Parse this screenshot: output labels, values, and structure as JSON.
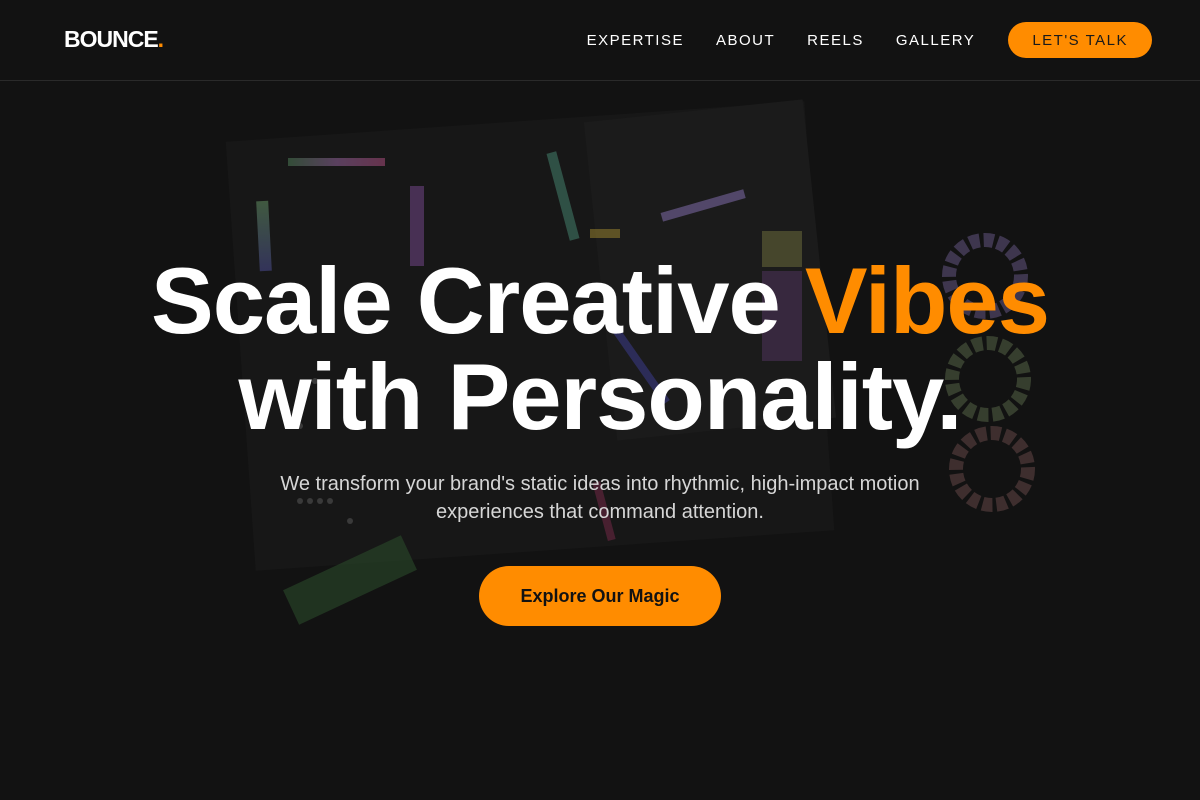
{
  "brand": {
    "name": "BOUNCE",
    "dot": ".",
    "accent_color": "#ff8c00",
    "background_color": "#121212"
  },
  "nav": {
    "items": [
      {
        "label": "EXPERTISE"
      },
      {
        "label": "ABOUT"
      },
      {
        "label": "REELS"
      },
      {
        "label": "GALLERY"
      }
    ],
    "cta_label": "LET'S TALK"
  },
  "hero": {
    "headline_line1_prefix": "Scale Creative ",
    "headline_line1_accent": "Vibes",
    "headline_line2": "with Personality.",
    "subtitle": "We transform your brand's static ideas into rhythmic, high-impact motion experiences that command attention.",
    "button_label": "Explore Our Magic",
    "background_image": "dark-creative-workspace-illustration"
  }
}
